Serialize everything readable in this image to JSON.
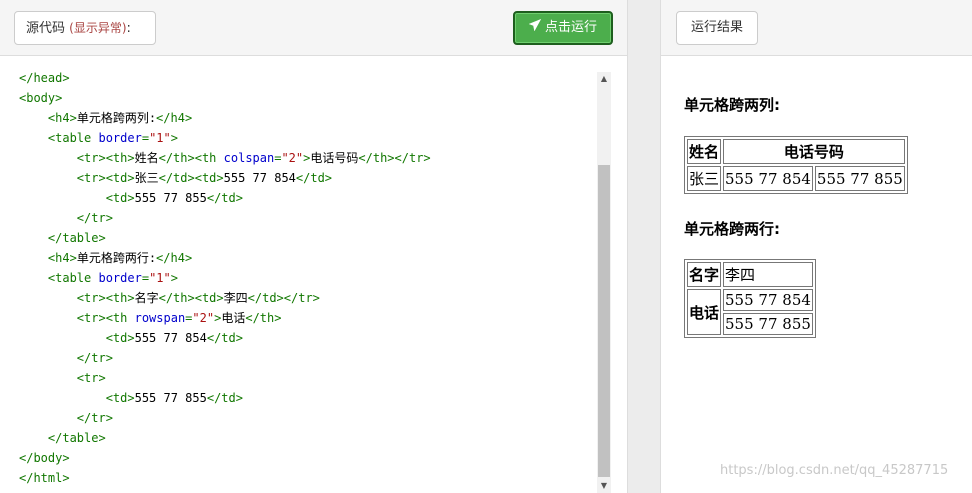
{
  "left_header": {
    "source_label": "源代码",
    "warn_label": "(显示异常)",
    "colon": ":",
    "run_label": "点击运行",
    "run_icon": "paper-plane-icon"
  },
  "right_header": {
    "result_label": "运行结果"
  },
  "code_lines": [
    [
      [
        "tag",
        "</head>"
      ]
    ],
    [
      [
        "tag",
        "<body>"
      ]
    ],
    [
      [
        "sp",
        "    "
      ],
      [
        "tag",
        "<h4>"
      ],
      [
        "txt",
        "单元格跨两列:"
      ],
      [
        "tag",
        "</h4>"
      ]
    ],
    [
      [
        "sp",
        "    "
      ],
      [
        "tag",
        "<table "
      ],
      [
        "attr",
        "border"
      ],
      [
        "tag",
        "="
      ],
      [
        "str",
        "\"1\""
      ],
      [
        "tag",
        ">"
      ]
    ],
    [
      [
        "sp",
        "        "
      ],
      [
        "tag",
        "<tr><th>"
      ],
      [
        "txt",
        "姓名"
      ],
      [
        "tag",
        "</th><th "
      ],
      [
        "attr",
        "colspan"
      ],
      [
        "tag",
        "="
      ],
      [
        "str",
        "\"2\""
      ],
      [
        "tag",
        ">"
      ],
      [
        "txt",
        "电话号码"
      ],
      [
        "tag",
        "</th></tr>"
      ]
    ],
    [
      [
        "sp",
        "        "
      ],
      [
        "tag",
        "<tr><td>"
      ],
      [
        "txt",
        "张三"
      ],
      [
        "tag",
        "</td><td>"
      ],
      [
        "txt",
        "555 77 854"
      ],
      [
        "tag",
        "</td>"
      ]
    ],
    [
      [
        "sp",
        "            "
      ],
      [
        "tag",
        "<td>"
      ],
      [
        "txt",
        "555 77 855"
      ],
      [
        "tag",
        "</td>"
      ]
    ],
    [
      [
        "sp",
        "        "
      ],
      [
        "tag",
        "</tr>"
      ]
    ],
    [
      [
        "sp",
        "    "
      ],
      [
        "tag",
        "</table>"
      ]
    ],
    [
      [
        "sp",
        "    "
      ],
      [
        "tag",
        "<h4>"
      ],
      [
        "txt",
        "单元格跨两行:"
      ],
      [
        "tag",
        "</h4>"
      ]
    ],
    [
      [
        "sp",
        "    "
      ],
      [
        "tag",
        "<table "
      ],
      [
        "attr",
        "border"
      ],
      [
        "tag",
        "="
      ],
      [
        "str",
        "\"1\""
      ],
      [
        "tag",
        ">"
      ]
    ],
    [
      [
        "sp",
        "        "
      ],
      [
        "tag",
        "<tr><th>"
      ],
      [
        "txt",
        "名字"
      ],
      [
        "tag",
        "</th><td>"
      ],
      [
        "txt",
        "李四"
      ],
      [
        "tag",
        "</td></tr>"
      ]
    ],
    [
      [
        "sp",
        "        "
      ],
      [
        "tag",
        "<tr><th "
      ],
      [
        "attr",
        "rowspan"
      ],
      [
        "tag",
        "="
      ],
      [
        "str",
        "\"2\""
      ],
      [
        "tag",
        ">"
      ],
      [
        "txt",
        "电话"
      ],
      [
        "tag",
        "</th>"
      ]
    ],
    [
      [
        "sp",
        "            "
      ],
      [
        "tag",
        "<td>"
      ],
      [
        "txt",
        "555 77 854"
      ],
      [
        "tag",
        "</td>"
      ]
    ],
    [
      [
        "sp",
        "        "
      ],
      [
        "tag",
        "</tr>"
      ]
    ],
    [
      [
        "sp",
        "        "
      ],
      [
        "tag",
        "<tr>"
      ]
    ],
    [
      [
        "sp",
        "            "
      ],
      [
        "tag",
        "<td>"
      ],
      [
        "txt",
        "555 77 855"
      ],
      [
        "tag",
        "</td>"
      ]
    ],
    [
      [
        "sp",
        "        "
      ],
      [
        "tag",
        "</tr>"
      ]
    ],
    [
      [
        "sp",
        "    "
      ],
      [
        "tag",
        "</table>"
      ]
    ],
    [
      [
        "tag",
        "</body>"
      ]
    ],
    [
      [
        "tag",
        "</html>"
      ]
    ]
  ],
  "result": {
    "heading1": "单元格跨两列:",
    "table1": {
      "h_name": "姓名",
      "h_phone": "电话号码",
      "name": "张三",
      "phone1": "555 77 854",
      "phone2": "555 77 855"
    },
    "heading2": "单元格跨两行:",
    "table2": {
      "h_name": "名字",
      "name": "李四",
      "h_phone": "电话",
      "phone1": "555 77 854",
      "phone2": "555 77 855"
    }
  },
  "watermark": "https://blog.csdn.net/qq_45287715",
  "colors": {
    "tag": "#117700",
    "attr": "#0000cc",
    "string": "#aa1111",
    "run_button": "#4cae4c"
  }
}
